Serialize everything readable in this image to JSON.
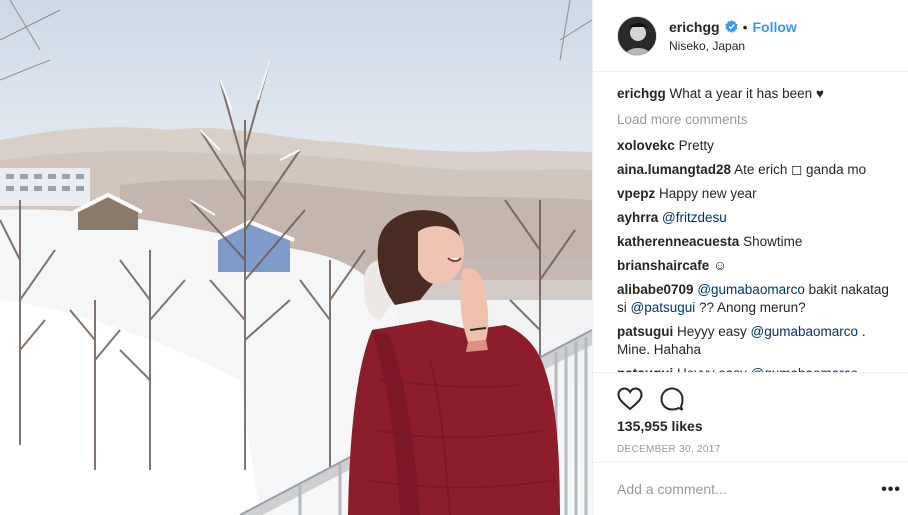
{
  "post": {
    "username": "erichgg",
    "follow_label": "Follow",
    "separator": "•",
    "location": "Niseko, Japan"
  },
  "caption": {
    "username": "erichgg",
    "text": "What a year it has been ♥"
  },
  "load_more": "Load more comments",
  "comments": [
    {
      "username": "xolovekc",
      "parts": [
        {
          "t": "Pretty"
        }
      ]
    },
    {
      "username": "aina.lumangtad28",
      "parts": [
        {
          "t": "Ate erich ◻ ganda mo"
        }
      ]
    },
    {
      "username": "vpepz",
      "parts": [
        {
          "t": "Happy new year"
        }
      ]
    },
    {
      "username": "ayhrra",
      "parts": [
        {
          "t": "@fritzdesu",
          "mention": true
        }
      ]
    },
    {
      "username": "katherenneacuesta",
      "parts": [
        {
          "t": "Showtime"
        }
      ]
    },
    {
      "username": "brianshaircafe",
      "parts": [
        {
          "t": "☺"
        }
      ]
    },
    {
      "username": "alibabe0709",
      "parts": [
        {
          "t": "@gumabaomarco",
          "mention": true
        },
        {
          "t": " bakit nakatag si "
        },
        {
          "t": "@patsugui",
          "mention": true
        },
        {
          "t": " ?? Anong merun?"
        }
      ]
    },
    {
      "username": "patsugui",
      "parts": [
        {
          "t": "Heyyy easy "
        },
        {
          "t": "@gumabaomarco",
          "mention": true
        },
        {
          "t": " . Mine. Hahaha"
        }
      ]
    },
    {
      "username": "patsugui",
      "parts": [
        {
          "t": "Heyyy easy "
        },
        {
          "t": "@gumabaomarco",
          "mention": true
        }
      ]
    }
  ],
  "likes": "135,955 likes",
  "date": "DECEMBER 30, 2017",
  "add_comment_placeholder": "Add a comment...",
  "more_label": "•••",
  "icons": {
    "like": "heart-icon",
    "comment": "comment-bubble-icon",
    "verified": "verified-badge-icon",
    "more": "more-options-icon"
  },
  "colors": {
    "link": "#3897f0",
    "mention": "#003569",
    "muted": "#999999",
    "text": "#262626",
    "jacket": "#8e1d2c"
  }
}
